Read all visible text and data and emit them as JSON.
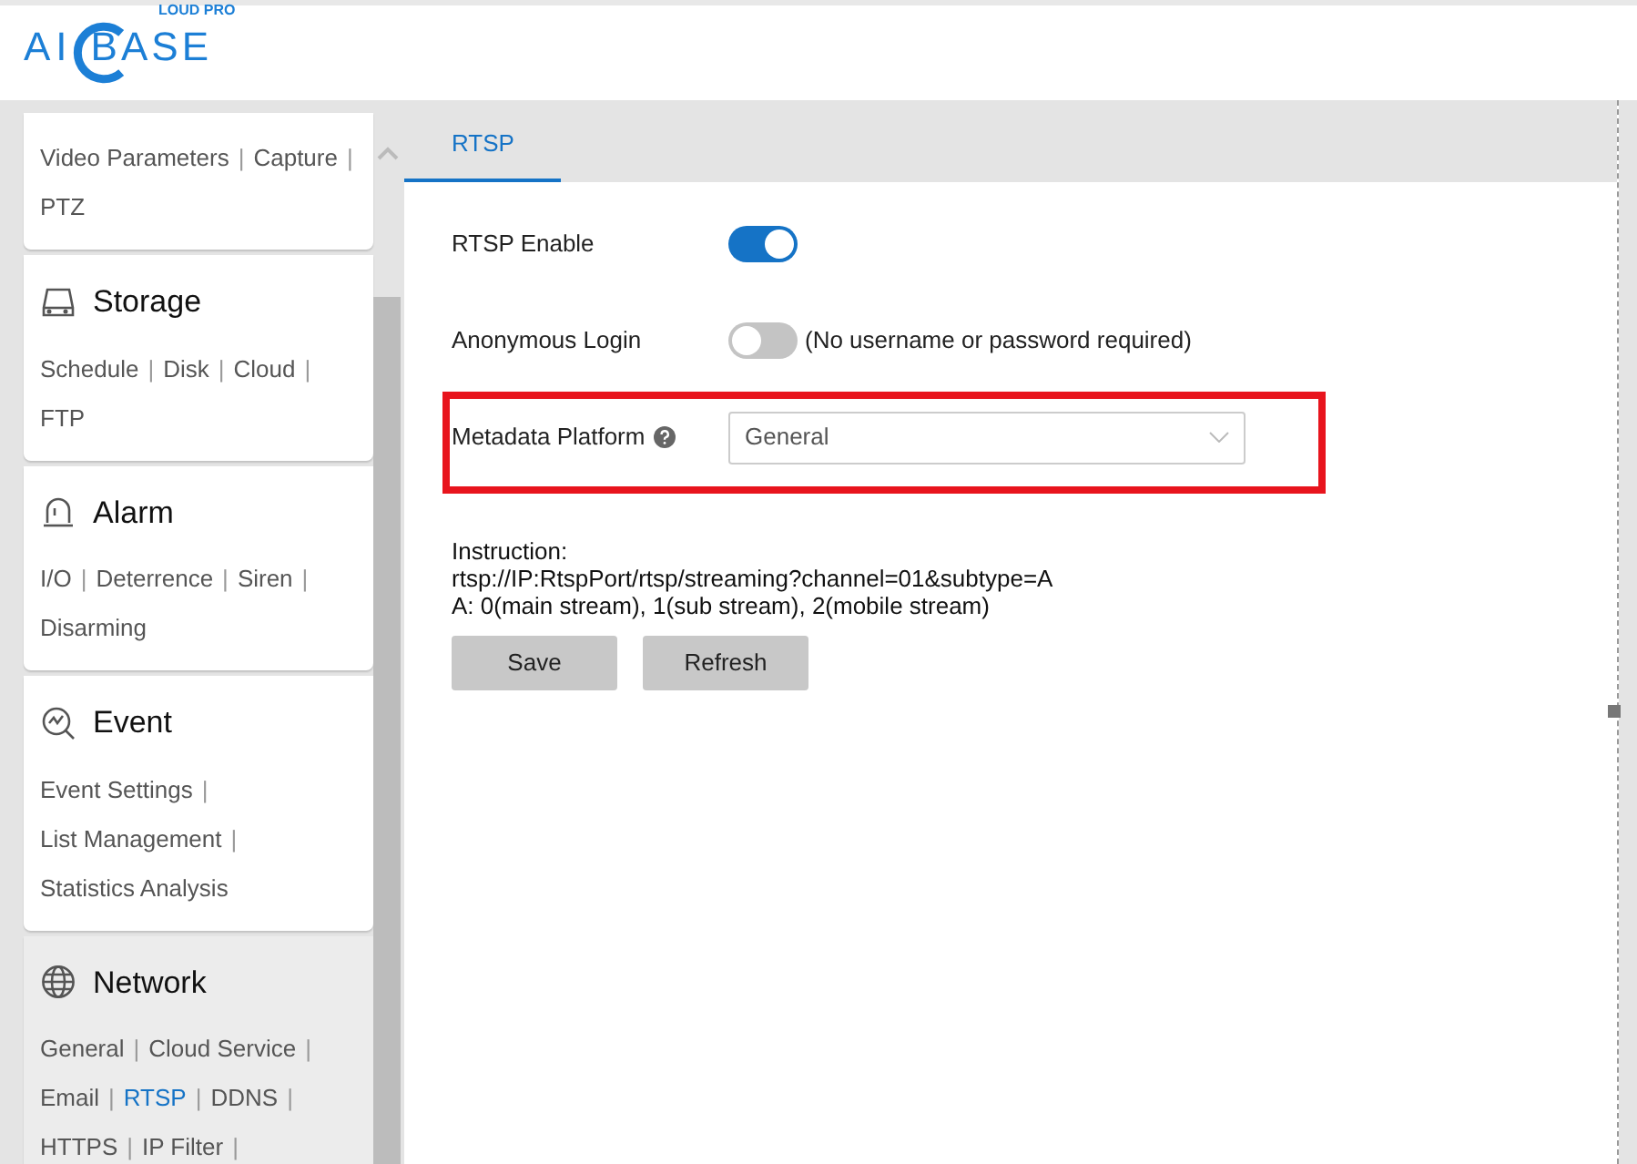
{
  "logo": {
    "left": "AI",
    "right": "BASE",
    "small": "LOUD PRO"
  },
  "sidebar": {
    "sections": [
      {
        "selected": false,
        "lines": [
          [
            {
              "label": "Video Parameters",
              "sep": "|",
              "selected": false
            },
            {
              "label": "Capture",
              "sep": "|",
              "selected": false
            }
          ],
          [
            {
              "label": "PTZ",
              "selected": false
            }
          ]
        ]
      },
      {
        "title": "Storage",
        "selected": false,
        "lines": [
          [
            {
              "label": "Schedule",
              "sep": "|",
              "selected": false
            },
            {
              "label": "Disk",
              "sep": "|",
              "selected": false
            },
            {
              "label": "Cloud",
              "sep": "|",
              "selected": false
            }
          ],
          [
            {
              "label": "FTP",
              "selected": false
            }
          ]
        ]
      },
      {
        "title": "Alarm",
        "selected": false,
        "lines": [
          [
            {
              "label": "I/O",
              "sep": "|",
              "selected": false
            },
            {
              "label": "Deterrence",
              "sep": "|",
              "selected": false
            },
            {
              "label": "Siren",
              "sep": "|",
              "selected": false
            }
          ],
          [
            {
              "label": "Disarming",
              "selected": false
            }
          ]
        ]
      },
      {
        "title": "Event",
        "selected": false,
        "lines": [
          [
            {
              "label": "Event Settings",
              "sep": "|",
              "selected": false
            }
          ],
          [
            {
              "label": "List Management",
              "sep": "|",
              "selected": false
            }
          ],
          [
            {
              "label": "Statistics Analysis",
              "selected": false
            }
          ]
        ]
      },
      {
        "title": "Network",
        "selected": true,
        "lines": [
          [
            {
              "label": "General",
              "sep": "|",
              "selected": false
            },
            {
              "label": "Cloud Service",
              "sep": "|",
              "selected": false
            }
          ],
          [
            {
              "label": "Email",
              "sep": "|",
              "selected": false
            },
            {
              "label": "RTSP",
              "sep": "|",
              "selected": true
            },
            {
              "label": "DDNS",
              "sep": "|",
              "selected": false
            }
          ],
          [
            {
              "label": "HTTPS",
              "sep": "|",
              "selected": false
            },
            {
              "label": "IP Filter",
              "sep": "|",
              "selected": false
            }
          ]
        ]
      }
    ]
  },
  "tabs": [
    {
      "label": "RTSP",
      "selected": true
    }
  ],
  "settings": [
    {
      "kind": "toggle",
      "label": "RTSP Enable",
      "on": true
    },
    {
      "kind": "toggle",
      "label": "Anonymous Login",
      "on": false,
      "note": "(No username or password required)"
    },
    {
      "kind": "select",
      "label": "Metadata Platform",
      "help": true,
      "value": "General",
      "highlighted": true
    }
  ],
  "instruction": [
    "Instruction:",
    "rtsp://IP:RtspPort/rtsp/streaming?channel=01&subtype=A",
    "A: 0(main stream), 1(sub stream), 2(mobile stream)"
  ],
  "buttons": [
    "Save",
    "Refresh"
  ]
}
